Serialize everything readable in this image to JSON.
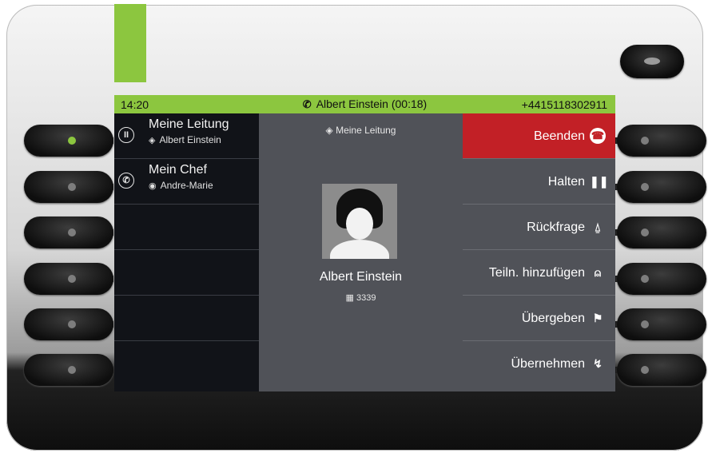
{
  "status_bar": {
    "time": "14:20",
    "call_label": "Albert Einstein (00:18)",
    "number": "+4415118302911"
  },
  "lines": [
    {
      "name": "Meine Leitung",
      "sub": "Albert Einstein",
      "state_icon": "pause-icon"
    },
    {
      "name": "Mein Chef",
      "sub": "Andre-Marie",
      "state_icon": "phone-icon"
    },
    {
      "name": "",
      "sub": ""
    },
    {
      "name": "",
      "sub": ""
    },
    {
      "name": "",
      "sub": ""
    },
    {
      "name": "",
      "sub": ""
    }
  ],
  "center": {
    "line_label": "Meine Leitung",
    "contact_name": "Albert Einstein",
    "extension": "3339"
  },
  "softkeys": [
    {
      "label": "Beenden",
      "icon": "hangup-icon"
    },
    {
      "label": "Halten",
      "icon": "pause-icon"
    },
    {
      "label": "Rückfrage",
      "icon": "consult-icon"
    },
    {
      "label": "Teiln. hinzufügen",
      "icon": "add-participant-icon"
    },
    {
      "label": "Übergeben",
      "icon": "transfer-icon"
    },
    {
      "label": "Übernehmen",
      "icon": "pickup-icon"
    }
  ],
  "colors": {
    "accent_green": "#8cc63f",
    "end_red": "#c22026",
    "panel_gray": "#505258",
    "dark_list": "#111318"
  }
}
